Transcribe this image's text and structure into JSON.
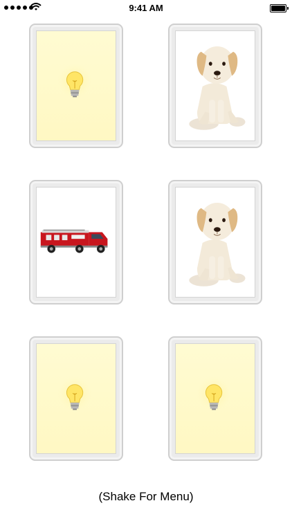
{
  "status_bar": {
    "time": "9:41 AM",
    "icons": [
      "signal-dots-icon",
      "wifi-icon",
      "battery-icon"
    ]
  },
  "cards": [
    {
      "image": "lightbulb-icon"
    },
    {
      "image": "puppy-image"
    },
    {
      "image": "fire-truck-image"
    },
    {
      "image": "puppy-image"
    },
    {
      "image": "lightbulb-icon"
    },
    {
      "image": "lightbulb-icon"
    }
  ],
  "footer": {
    "hint": "(Shake For Menu)"
  },
  "colors": {
    "card_back": "#fff8c3",
    "card_frame": "#ebebeb"
  }
}
